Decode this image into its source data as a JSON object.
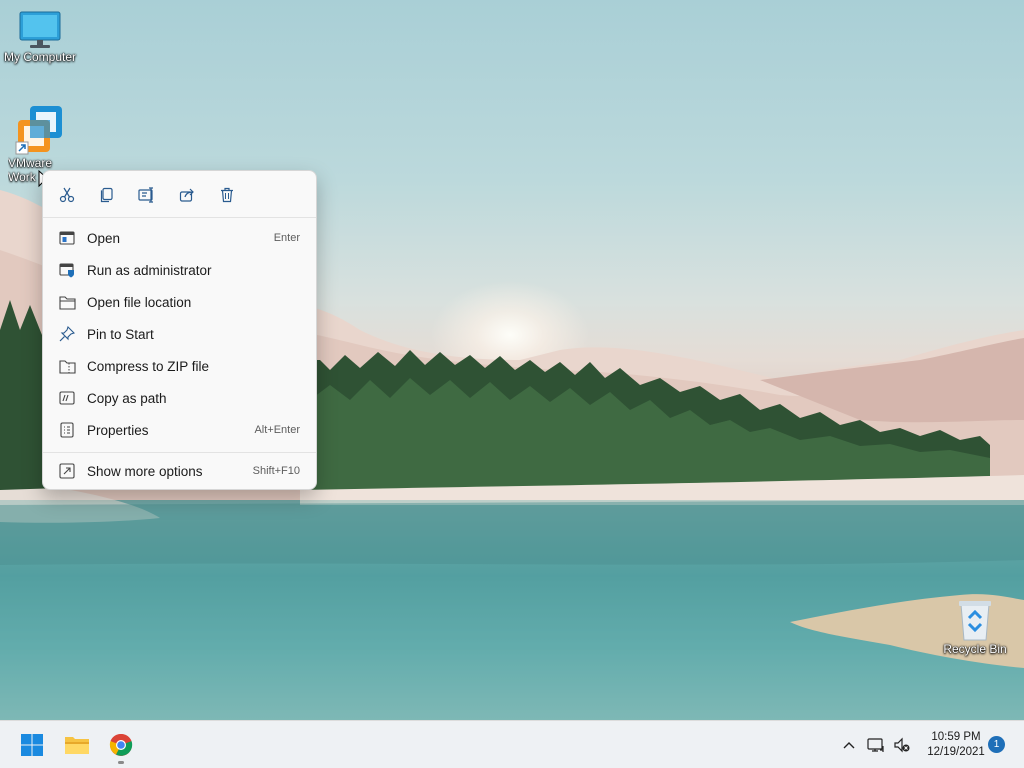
{
  "desktop": {
    "icons": [
      {
        "label": "My Computer",
        "icon": "monitor-icon"
      },
      {
        "label": "VMware Work",
        "icon": "vmware-icon"
      },
      {
        "label": "Recycle Bin",
        "icon": "recycle-bin-icon"
      }
    ]
  },
  "context_menu": {
    "quick_actions": [
      {
        "name": "cut",
        "icon": "scissors-icon"
      },
      {
        "name": "copy",
        "icon": "copy-icon"
      },
      {
        "name": "rename",
        "icon": "rename-icon"
      },
      {
        "name": "share",
        "icon": "share-icon"
      },
      {
        "name": "delete",
        "icon": "trash-icon"
      }
    ],
    "items": [
      {
        "label": "Open",
        "shortcut": "Enter",
        "icon": "open-icon"
      },
      {
        "label": "Run as administrator",
        "shortcut": "",
        "icon": "shield-window-icon"
      },
      {
        "label": "Open file location",
        "shortcut": "",
        "icon": "folder-icon"
      },
      {
        "label": "Pin to Start",
        "shortcut": "",
        "icon": "pin-icon"
      },
      {
        "label": "Compress to ZIP file",
        "shortcut": "",
        "icon": "zip-folder-icon"
      },
      {
        "label": "Copy as path",
        "shortcut": "",
        "icon": "path-icon"
      },
      {
        "label": "Properties",
        "shortcut": "Alt+Enter",
        "icon": "properties-icon"
      },
      {
        "label": "Show more options",
        "shortcut": "Shift+F10",
        "icon": "more-options-icon"
      }
    ]
  },
  "taskbar": {
    "apps": [
      {
        "name": "start",
        "icon": "windows-logo-icon"
      },
      {
        "name": "file-explorer",
        "icon": "folder-icon"
      },
      {
        "name": "chrome",
        "icon": "chrome-icon"
      }
    ],
    "tray": {
      "icons": [
        "chevron-up-icon",
        "network-icon",
        "volume-muted-icon"
      ],
      "time": "10:59 PM",
      "date": "12/19/2021",
      "notification_count": "1"
    }
  },
  "colors": {
    "accent": "#1f6fb8",
    "menu_bg": "#f9f9f9",
    "taskbar_bg": "#eef1f4"
  }
}
